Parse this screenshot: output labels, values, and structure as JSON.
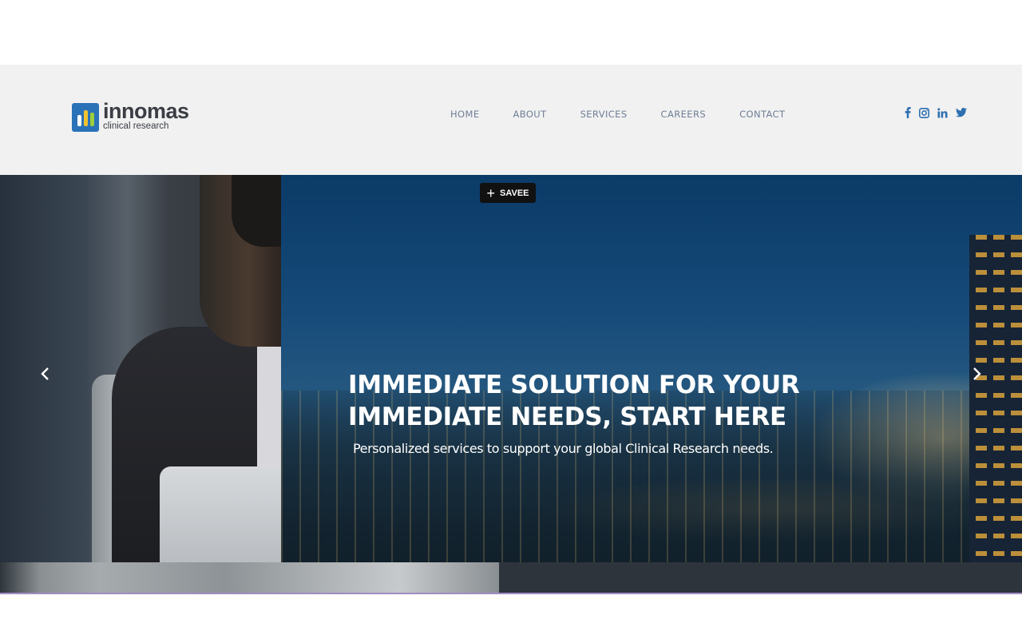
{
  "brand": {
    "name": "innomas",
    "tagline": "clinical research",
    "colors": {
      "mark": "#2a72b8",
      "bar1": "#ffffff",
      "bar2": "#f1c232",
      "bar3": "#9ccf3c"
    }
  },
  "nav": {
    "items": [
      {
        "label": "HOME"
      },
      {
        "label": "ABOUT"
      },
      {
        "label": "SERVICES"
      },
      {
        "label": "CAREERS"
      },
      {
        "label": "CONTACT"
      }
    ],
    "color": "#6f7e96"
  },
  "social": {
    "icons": [
      "facebook-icon",
      "instagram-icon",
      "linkedin-icon",
      "twitter-icon"
    ],
    "color": "#2e6fb1"
  },
  "save_button": {
    "label": "SAVEE"
  },
  "hero": {
    "headline_line1": "IMMEDIATE SOLUTION FOR YOUR",
    "headline_line2": "IMMEDIATE NEEDS, START HERE",
    "subtitle": "Personalized services to support your global Clinical Research needs.",
    "prev_icon": "chevron-left-icon",
    "next_icon": "chevron-right-icon"
  }
}
